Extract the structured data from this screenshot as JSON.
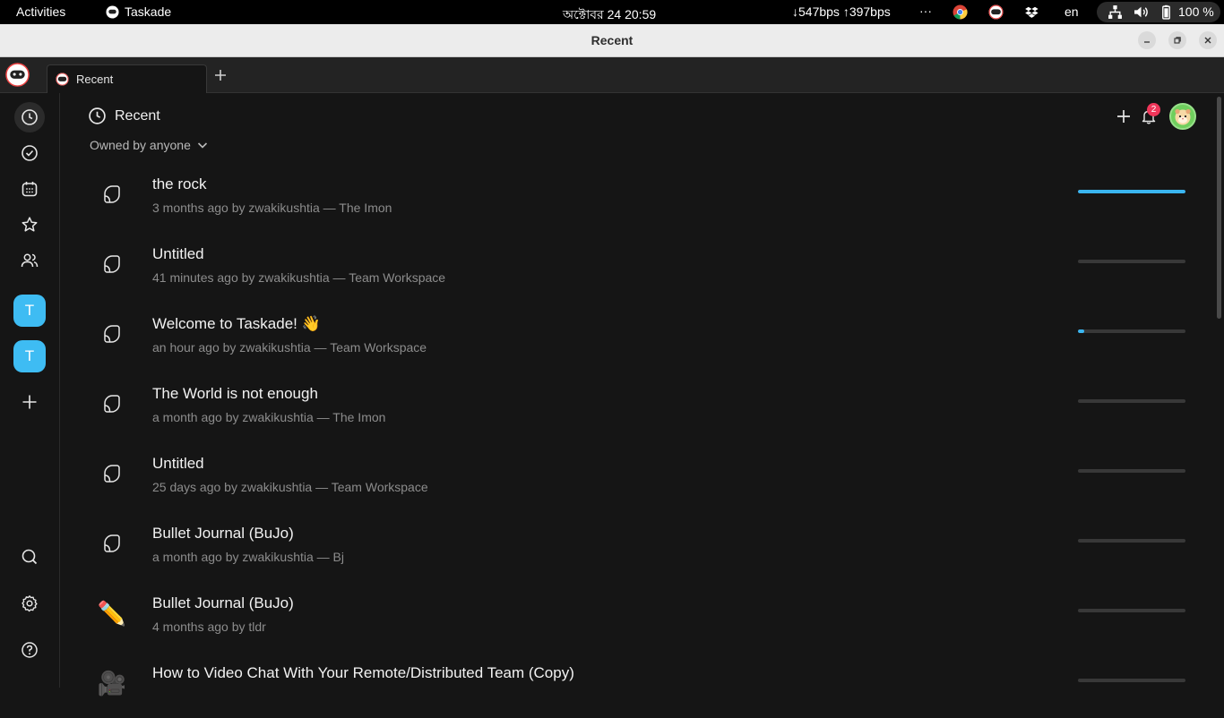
{
  "topbar": {
    "activities": "Activities",
    "app_name": "Taskade",
    "clock": "অক্টোবর 24  20:59",
    "network": "↓547bps ↑397bps",
    "overflow": "···",
    "language": "en",
    "battery": "100 %"
  },
  "window": {
    "title": "Recent"
  },
  "tabs": [
    {
      "label": "Recent"
    }
  ],
  "page": {
    "title": "Recent",
    "owner_filter": "Owned by anyone",
    "notification_count": "2"
  },
  "workspaces": [
    {
      "letter": "T"
    },
    {
      "letter": "T"
    }
  ],
  "items": [
    {
      "title": "the rock",
      "meta": "3 months ago by zwakikushtia — The Imon",
      "icon": "document-icon",
      "progress": 1.0
    },
    {
      "title": "Untitled",
      "meta": "41 minutes ago by zwakikushtia — Team Workspace",
      "icon": "document-icon",
      "progress": 0
    },
    {
      "title": "Welcome to Taskade! 👋",
      "meta": "an hour ago by zwakikushtia — Team Workspace",
      "icon": "document-icon",
      "progress": 0.05
    },
    {
      "title": "The World is not enough",
      "meta": "a month ago by zwakikushtia — The Imon",
      "icon": "document-icon",
      "progress": 0
    },
    {
      "title": "Untitled",
      "meta": "25 days ago by zwakikushtia — Team Workspace",
      "icon": "document-icon",
      "progress": 0
    },
    {
      "title": "Bullet Journal (BuJo)",
      "meta": "a month ago by zwakikushtia — Bj",
      "icon": "document-icon",
      "progress": 0
    },
    {
      "title": "Bullet Journal (BuJo)",
      "meta": "4 months ago by tldr",
      "icon": "pencil-emoji-icon",
      "emoji": "✏️",
      "progress": 0
    },
    {
      "title": "How to Video Chat With Your Remote/Distributed Team (Copy)",
      "meta": "",
      "icon": "video-camera-emoji-icon",
      "emoji": "🎥",
      "progress": 0
    }
  ],
  "colors": {
    "accent": "#3ab5f0",
    "workspace": "#3ebcf3",
    "badge": "#f0365a",
    "background": "#151515"
  }
}
